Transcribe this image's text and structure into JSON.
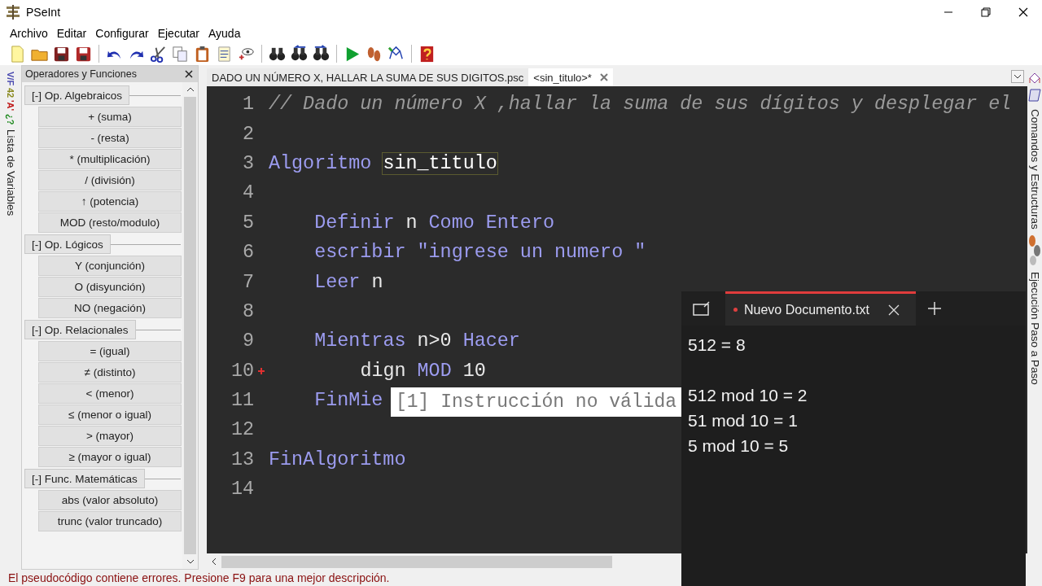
{
  "window": {
    "title": "PSeInt"
  },
  "menu": [
    {
      "label": "Archivo"
    },
    {
      "label": "Editar"
    },
    {
      "label": "Configurar"
    },
    {
      "label": "Ejecutar"
    },
    {
      "label": "Ayuda"
    }
  ],
  "left_dock": {
    "type_labels": [
      {
        "text": "V/F",
        "color": "#4a4ab0"
      },
      {
        "text": "42",
        "color": "#8a8a20"
      },
      {
        "text": "'A'",
        "color": "#c02020"
      },
      {
        "text": "¿?",
        "color": "#208a20"
      }
    ],
    "tab": "Lista de Variables"
  },
  "operators_panel": {
    "title": "Operadores y Funciones",
    "groups": [
      {
        "label": "[-] Op. Algebraicos",
        "items": [
          "+ (suma)",
          "- (resta)",
          "* (multiplicación)",
          "/ (división)",
          "↑ (potencia)",
          "MOD (resto/modulo)"
        ]
      },
      {
        "label": "[-] Op. Lógicos",
        "items": [
          "Y (conjunción)",
          "O (disyunción)",
          "NO (negación)"
        ]
      },
      {
        "label": "[-] Op. Relacionales",
        "items": [
          "= (igual)",
          "≠ (distinto)",
          "< (menor)",
          "≤ (menor o igual)",
          "> (mayor)",
          "≥ (mayor o igual)"
        ]
      },
      {
        "label": "[-] Func. Matemáticas",
        "items": [
          "abs (valor absoluto)",
          "trunc (valor truncado)"
        ]
      }
    ]
  },
  "editor": {
    "tabs": [
      {
        "label": "DADO UN NÚMERO X, HALLAR LA SUMA DE SUS DIGITOS.psc",
        "selected": false
      },
      {
        "label": "<sin_titulo>*",
        "selected": true
      }
    ],
    "lines": [
      {
        "number": "1",
        "error": false,
        "tokens": [
          {
            "kind": "comment",
            "text": "// Dado un número X ,hallar la suma de sus dígitos y desplegar el"
          }
        ]
      },
      {
        "number": "2",
        "error": false
      },
      {
        "number": "3",
        "error": false,
        "tokens": [
          {
            "kind": "keyword",
            "text": "Algoritmo "
          },
          {
            "kind": "match",
            "text": "sin_titulo"
          }
        ],
        "children": [
          {
            "number": "4",
            "error": false
          },
          {
            "number": "5",
            "error": false,
            "tokens": [
              {
                "kind": "keyword",
                "text": "Definir"
              },
              {
                "kind": "plain",
                "text": " n "
              },
              {
                "kind": "keyword",
                "text": "Como Entero"
              }
            ]
          },
          {
            "number": "6",
            "error": false,
            "tokens": [
              {
                "kind": "keyword",
                "text": "escribir "
              },
              {
                "kind": "string",
                "text": "\"ingrese un numero \""
              }
            ]
          },
          {
            "number": "7",
            "error": false,
            "tokens": [
              {
                "kind": "keyword",
                "text": "Leer"
              },
              {
                "kind": "plain",
                "text": " n"
              }
            ]
          },
          {
            "number": "8",
            "error": false
          },
          {
            "number": "9",
            "error": false,
            "tokens": [
              {
                "kind": "keyword",
                "text": "Mientras"
              },
              {
                "kind": "plain",
                "text": " n>0 "
              },
              {
                "kind": "keyword",
                "text": "Hacer"
              }
            ],
            "children": [
              {
                "number": "10",
                "error": true,
                "tokens": [
                  {
                    "kind": "plain",
                    "text": "dign"
                  },
                  {
                    "kind": "keyword",
                    "text": " MOD"
                  },
                  {
                    "kind": "plain",
                    "text": " 10"
                  }
                ]
              }
            ]
          },
          {
            "number": "11",
            "error": false,
            "tokens": [
              {
                "kind": "keyword",
                "text": "FinMie"
              }
            ]
          },
          {
            "number": "12",
            "error": false
          }
        ]
      },
      {
        "number": "13",
        "error": false,
        "tokens": [
          {
            "kind": "keyword",
            "text": "FinAlgoritmo"
          }
        ]
      },
      {
        "number": "14",
        "error": false
      }
    ],
    "tooltip": "[1] Instrucción no válida"
  },
  "right_dock": {
    "tabs": [
      "Comandos y Estructuras",
      "Ejecución Paso a Paso"
    ]
  },
  "status_bar": "El pseudocódigo contiene errores. Presione F9 para una mejor descripción.",
  "notepad": {
    "tabs": [
      {
        "label": "Nuevo Documento.txt",
        "selected": true,
        "unsaved": true
      }
    ],
    "paragraphs": [
      [
        "512 = 8"
      ],
      [
        "512 mod 10 = 2",
        "51 mod 10 = 1",
        "5 mod 10 = 5"
      ]
    ]
  }
}
